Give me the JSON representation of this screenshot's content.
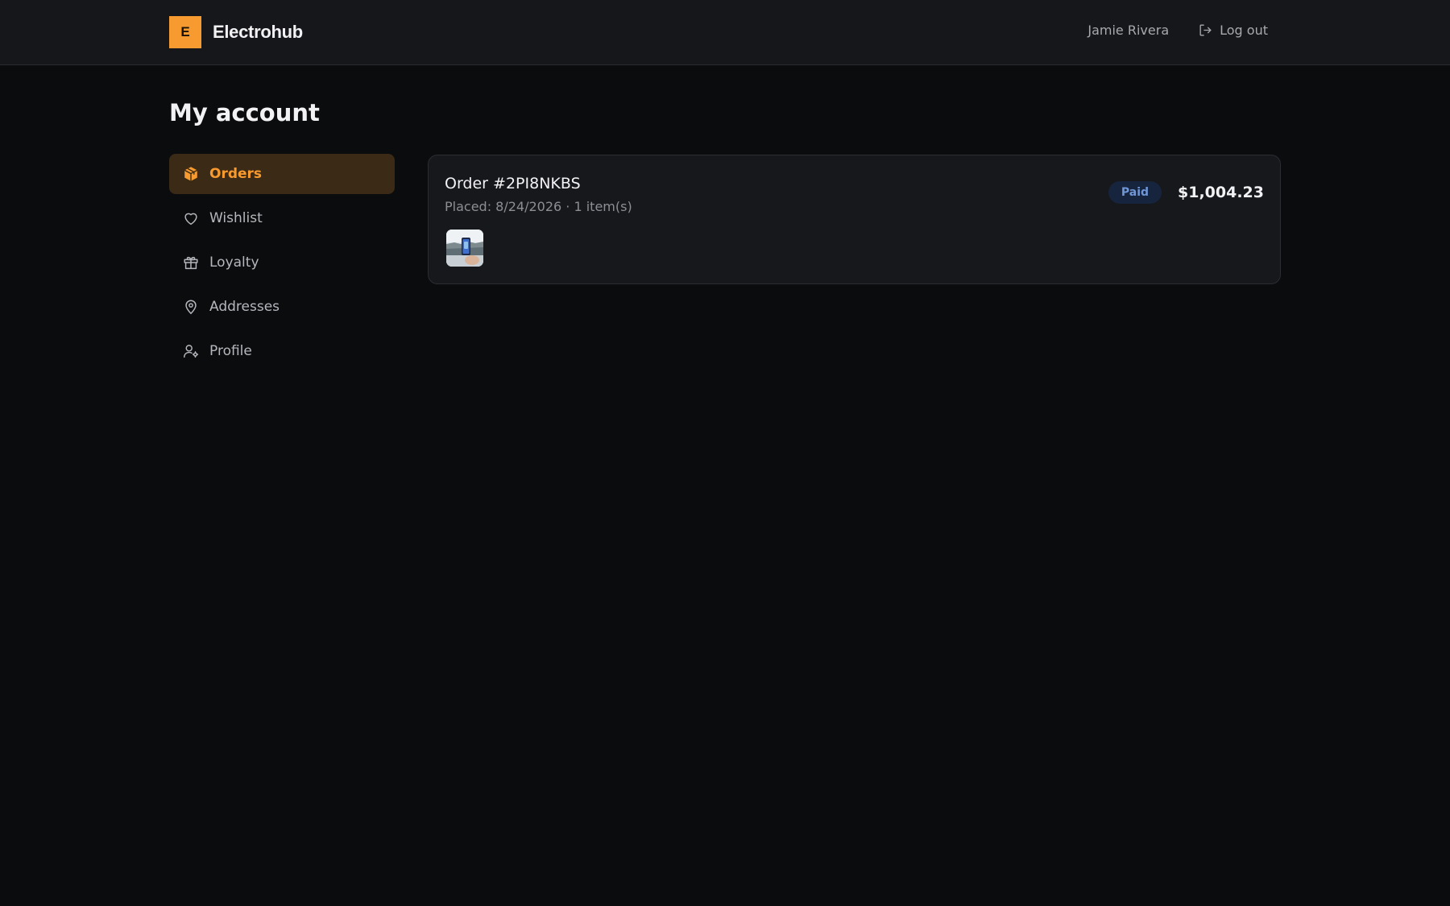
{
  "header": {
    "brand_mark": "E",
    "brand_name": "Electrohub",
    "user_name": "Jamie Rivera",
    "logout_label": "Log out"
  },
  "page": {
    "title": "My account"
  },
  "sidebar": {
    "items": [
      {
        "label": "Orders",
        "icon": "package-icon",
        "active": true
      },
      {
        "label": "Wishlist",
        "icon": "heart-icon",
        "active": false
      },
      {
        "label": "Loyalty",
        "icon": "gift-icon",
        "active": false
      },
      {
        "label": "Addresses",
        "icon": "map-pin-icon",
        "active": false
      },
      {
        "label": "Profile",
        "icon": "user-gear-icon",
        "active": false
      }
    ]
  },
  "orders": [
    {
      "id_label": "Order #2PI8NKBS",
      "meta": "Placed: 8/24/2026 · 1 item(s)",
      "status": "Paid",
      "total": "$1,004.23",
      "thumbnail": "phone-product-thumbnail"
    }
  ],
  "colors": {
    "accent": "#f79a30",
    "active_bg": "#3a2a16",
    "badge_bg": "#17243d",
    "badge_text": "#6f97d8",
    "page_bg": "#0b0c0e",
    "card_bg": "#17181c"
  }
}
